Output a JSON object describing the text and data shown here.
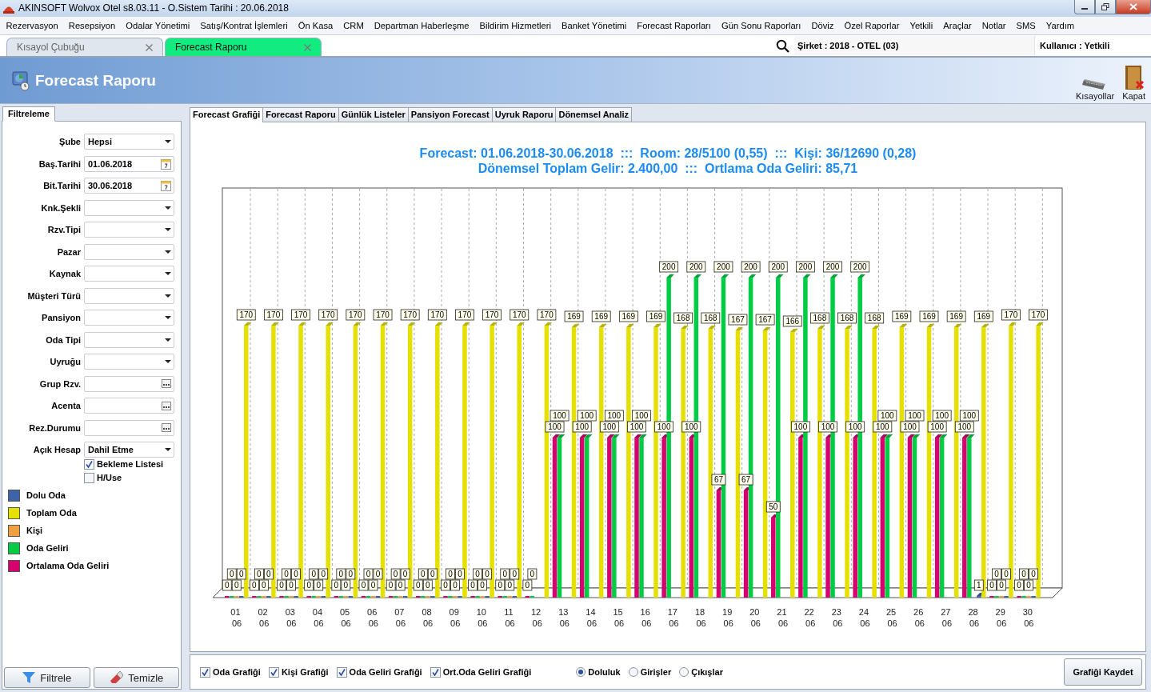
{
  "window": {
    "title": "AKINSOFT Wolvox Otel s8.03.11 - O.Sistem Tarihi : 20.06.2018"
  },
  "menu": [
    "Rezervasyon",
    "Resepsiyon",
    "Odalar Yönetimi",
    "Satış/Kontrat İşlemleri",
    "Ön Kasa",
    "CRM",
    "Departman Haberleşme",
    "Bildirim Hizmetleri",
    "Banket Yönetimi",
    "Forecast Raporları",
    "Gün Sonu Raporları",
    "Döviz",
    "Özel Raporlar",
    "Yetkili",
    "Araçlar",
    "Notlar",
    "SMS",
    "Yardım"
  ],
  "doc_tabs": [
    {
      "label": "Kısayol Çubuğu",
      "selected": false
    },
    {
      "label": "Forecast Raporu",
      "selected": true
    }
  ],
  "status": {
    "company": "Şirket : 2018 - OTEL (03)",
    "user": "Kullanıcı : Yetkili"
  },
  "header": {
    "title": "Forecast Raporu",
    "tools": [
      {
        "label": "Kısayollar",
        "kind": "keyboard"
      },
      {
        "label": "Kapat",
        "kind": "exit"
      }
    ]
  },
  "filter": {
    "tab": "Filtreleme",
    "fields": [
      {
        "label": "Şube",
        "kind": "dropdown",
        "value": "Hepsi"
      },
      {
        "label": "Baş.Tarihi",
        "kind": "date",
        "value": "01.06.2018"
      },
      {
        "label": "Bit.Tarihi",
        "kind": "date",
        "value": "30.06.2018"
      },
      {
        "label": "Knk.Şekli",
        "kind": "dropdown"
      },
      {
        "label": "Rzv.Tipi",
        "kind": "dropdown"
      },
      {
        "label": "Pazar",
        "kind": "dropdown"
      },
      {
        "label": "Kaynak",
        "kind": "dropdown"
      },
      {
        "label": "Müşteri Türü",
        "kind": "dropdown"
      },
      {
        "label": "Pansiyon",
        "kind": "dropdown"
      },
      {
        "label": "Oda Tipi",
        "kind": "dropdown"
      },
      {
        "label": "Uyruğu",
        "kind": "dropdown"
      },
      {
        "label": "Grup Rzv.",
        "kind": "lookup"
      },
      {
        "label": "Acenta",
        "kind": "lookup"
      },
      {
        "label": "Rez.Durumu",
        "kind": "lookup"
      },
      {
        "label": "Açık Hesap",
        "kind": "dropdown",
        "value": "Dahil Etme"
      }
    ],
    "options": [
      {
        "label": "Bekleme Listesi",
        "checked": true
      },
      {
        "label": "H/Use",
        "checked": false
      }
    ],
    "buttons": [
      {
        "label": "Filtrele",
        "kind": "filter"
      },
      {
        "label": "Temizle",
        "kind": "clear"
      }
    ]
  },
  "report_tabs": [
    {
      "label": "Forecast Grafiği",
      "selected": true
    },
    {
      "label": "Forecast Raporu",
      "selected": false
    },
    {
      "label": "Günlük Listeler",
      "selected": false
    },
    {
      "label": "Pansiyon Forecast",
      "selected": false
    },
    {
      "label": "Uyruk Raporu",
      "selected": false
    },
    {
      "label": "Dönemsel Analiz",
      "selected": false
    }
  ],
  "report": {
    "headline": [
      "Forecast: 01.06.2018-30.06.2018  :::  Room: 28/5100 (0,55)  :::  Kişi: 36/12690 (0,28)",
      "Dönemsel Toplam Gelir: 2.400,00  :::  Ortlama Oda Geliri: 85,71"
    ],
    "chart_data": {
      "type": "bar",
      "data_labels": true,
      "categories": [
        "01 06",
        "02 06",
        "03 06",
        "04 06",
        "05 06",
        "06 06",
        "07 06",
        "08 06",
        "09 06",
        "10 06",
        "11 06",
        "12 06",
        "13 06",
        "14 06",
        "15 06",
        "16 06",
        "17 06",
        "18 06",
        "19 06",
        "20 06",
        "21 06",
        "22 06",
        "23 06",
        "24 06",
        "25 06",
        "26 06",
        "27 06",
        "28 06",
        "29 06",
        "30 06"
      ],
      "series": [
        {
          "name": "Dolu Oda",
          "color": "#3f63a8",
          "values": [
            0,
            0,
            0,
            0,
            0,
            0,
            0,
            0,
            0,
            0,
            0,
            null,
            null,
            null,
            null,
            null,
            null,
            null,
            null,
            null,
            null,
            null,
            null,
            null,
            null,
            null,
            null,
            1,
            0,
            0
          ]
        },
        {
          "name": "Toplam Oda",
          "color": "#e6e000",
          "values": [
            170,
            170,
            170,
            170,
            170,
            170,
            170,
            170,
            170,
            170,
            170,
            170,
            169,
            169,
            169,
            169,
            168,
            168,
            167,
            167,
            166,
            168,
            168,
            168,
            169,
            169,
            169,
            169,
            170,
            170
          ]
        },
        {
          "name": "Kişi",
          "color": "#f0a040",
          "values": [
            0,
            0,
            0,
            0,
            0,
            0,
            0,
            0,
            0,
            0,
            0,
            null,
            null,
            null,
            null,
            null,
            null,
            null,
            null,
            null,
            null,
            null,
            null,
            null,
            null,
            null,
            null,
            null,
            0,
            0
          ]
        },
        {
          "name": "Oda Geliri",
          "color": "#00cc44",
          "values": [
            0,
            0,
            0,
            0,
            0,
            0,
            0,
            0,
            0,
            0,
            0,
            0,
            100,
            100,
            100,
            100,
            200,
            200,
            200,
            200,
            200,
            200,
            200,
            200,
            100,
            100,
            100,
            100,
            0,
            0
          ]
        },
        {
          "name": "Ortalama Oda Geliri",
          "color": "#d6006e",
          "values": [
            0,
            0,
            0,
            0,
            0,
            0,
            0,
            0,
            0,
            0,
            0,
            0,
            100,
            100,
            100,
            100,
            100,
            100,
            67,
            67,
            50,
            100,
            100,
            100,
            100,
            100,
            100,
            100,
            0,
            0
          ]
        }
      ]
    }
  },
  "chart_options": {
    "toggles": [
      {
        "label": "Oda Grafiği",
        "checked": true
      },
      {
        "label": "Kişi Grafiği",
        "checked": true
      },
      {
        "label": "Oda Geliri Grafiği",
        "checked": true
      },
      {
        "label": "Ort.Oda Geliri Grafiği",
        "checked": true
      }
    ],
    "modes": [
      {
        "label": "Doluluk",
        "selected": true
      },
      {
        "label": "Girişler",
        "selected": false
      },
      {
        "label": "Çıkışlar",
        "selected": false
      }
    ],
    "save_button": "Grafiği Kaydet"
  }
}
